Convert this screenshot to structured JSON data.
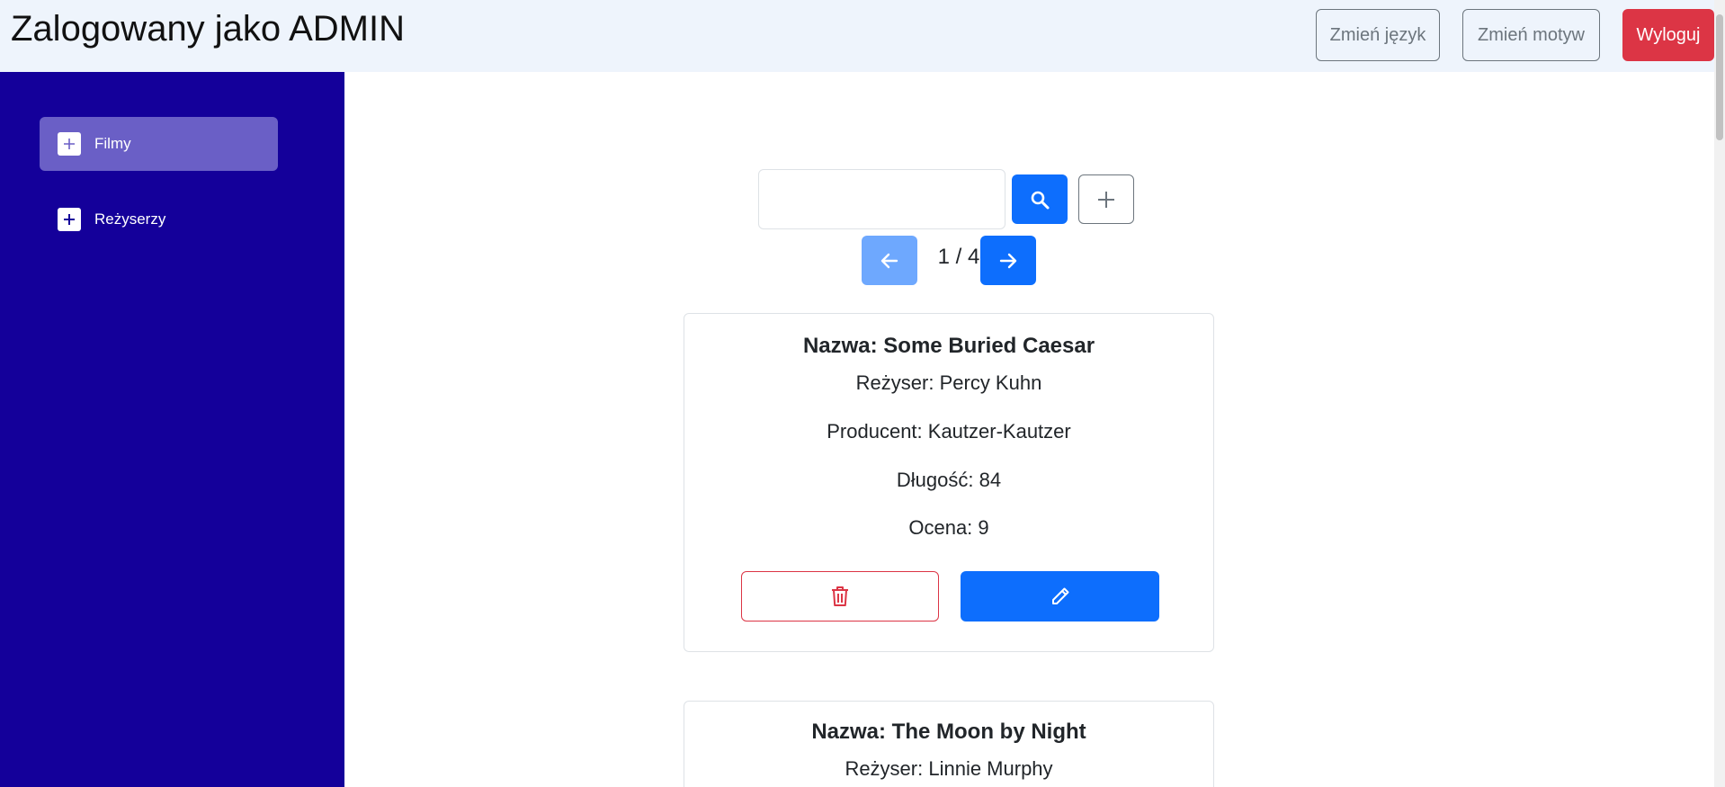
{
  "header": {
    "title": "Zalogowany jako ADMIN",
    "change_language_label": "Zmień język",
    "change_theme_label": "Zmień motyw",
    "logout_label": "Wyloguj"
  },
  "sidebar": {
    "items": [
      {
        "label": "Filmy",
        "icon": "plus-icon",
        "active": true
      },
      {
        "label": "Reżyserzy",
        "icon": "plus-icon",
        "active": false
      }
    ]
  },
  "search": {
    "value": "",
    "placeholder": "",
    "search_icon": "search-icon",
    "add_icon": "plus-icon"
  },
  "pagination": {
    "text": "1 / 4",
    "prev_icon": "arrow-left-icon",
    "next_icon": "arrow-right-icon"
  },
  "films": [
    {
      "title": "Nazwa: Some Buried Caesar",
      "director": "Reżyser: Percy Kuhn",
      "producer": "Producent: Kautzer-Kautzer",
      "length": "Długość: 84",
      "rating": "Ocena: 9"
    },
    {
      "title": "Nazwa: The Moon by Night",
      "director": "Reżyser: Linnie Murphy"
    }
  ],
  "colors": {
    "sidebar_bg": "#14009a",
    "sidebar_active": "#6a5fc6",
    "header_bg": "#eef4fc",
    "primary": "#0d6efd",
    "primary_disabled": "#6ea8fe",
    "danger": "#dc3545"
  }
}
